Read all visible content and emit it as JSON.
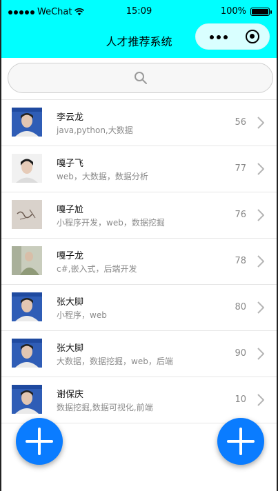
{
  "status_bar": {
    "carrier": "WeChat",
    "time": "15:09",
    "battery": "100%",
    "battery_level": 1.0
  },
  "nav": {
    "title": "人才推荐系统"
  },
  "search": {
    "placeholder": ""
  },
  "candidates": [
    {
      "name": "李云龙",
      "skills": "java,python,大数据",
      "score": "56",
      "avatar": "blue-photo"
    },
    {
      "name": "嘎子飞",
      "skills": "web，大数据，数据分析",
      "score": "77",
      "avatar": "light-photo"
    },
    {
      "name": "嘎子尬",
      "skills": "小程序开发，web，数据挖掘",
      "score": "76",
      "avatar": "paper-photo"
    },
    {
      "name": "嘎子龙",
      "skills": "c#,嵌入式，后端开发",
      "score": "78",
      "avatar": "green-photo"
    },
    {
      "name": "张大脚",
      "skills": "小程序，web",
      "score": "80",
      "avatar": "blue-photo"
    },
    {
      "name": "张大脚",
      "skills": "大数据，数据挖掘，web，后端",
      "score": "90",
      "avatar": "blue-photo"
    },
    {
      "name": "谢保庆",
      "skills": "数据挖掘,数据可视化,前端",
      "score": "10",
      "avatar": "blue-photo"
    }
  ],
  "colors": {
    "header": "#00ffff",
    "fab": "#0a7cff"
  },
  "icons": {
    "search": "search-icon",
    "chevron": "chevron-right-icon",
    "fab": "plus-icon"
  }
}
